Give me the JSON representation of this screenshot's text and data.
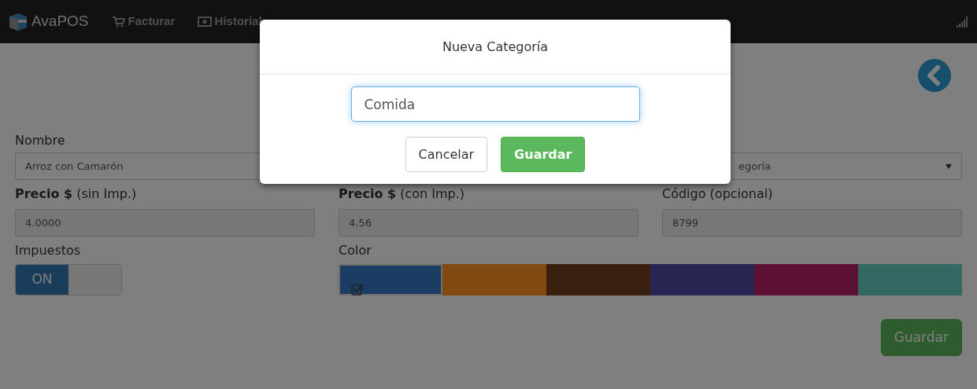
{
  "navbar": {
    "brand": "AvaPOS",
    "items": [
      {
        "kind": "cart",
        "label": "Facturar"
      },
      {
        "kind": "money",
        "label": "Historial"
      }
    ]
  },
  "form": {
    "nombre": {
      "label": "Nombre",
      "value": "Arroz con Camarón"
    },
    "categoria": {
      "value": "egoría"
    },
    "precio_sin": {
      "label": "**Precio $** (sin Imp.)",
      "value": "4.0000"
    },
    "precio_con": {
      "label": "**Precio $** (con Imp.)",
      "value": "4.56"
    },
    "codigo": {
      "label": "Código (opcional)",
      "value": "8799"
    },
    "impuestos": {
      "label": "Impuestos",
      "on": true,
      "on_label": "ON"
    },
    "color": {
      "label": "Color",
      "swatches": [
        {
          "color": "#1c3d63",
          "selected": true
        },
        {
          "color": "#804a12",
          "selected": false
        },
        {
          "color": "#3a200e",
          "selected": false
        },
        {
          "color": "#292552",
          "selected": false
        },
        {
          "color": "#5c1034",
          "selected": false
        },
        {
          "color": "#346862",
          "selected": false
        }
      ]
    },
    "save_button": "Guardar"
  },
  "modal": {
    "title": "Nueva Categoría",
    "input_value": "Comida",
    "buttons": [
      {
        "kind": "default",
        "label": "Cancelar"
      },
      {
        "kind": "success",
        "label": "Guardar"
      }
    ]
  }
}
